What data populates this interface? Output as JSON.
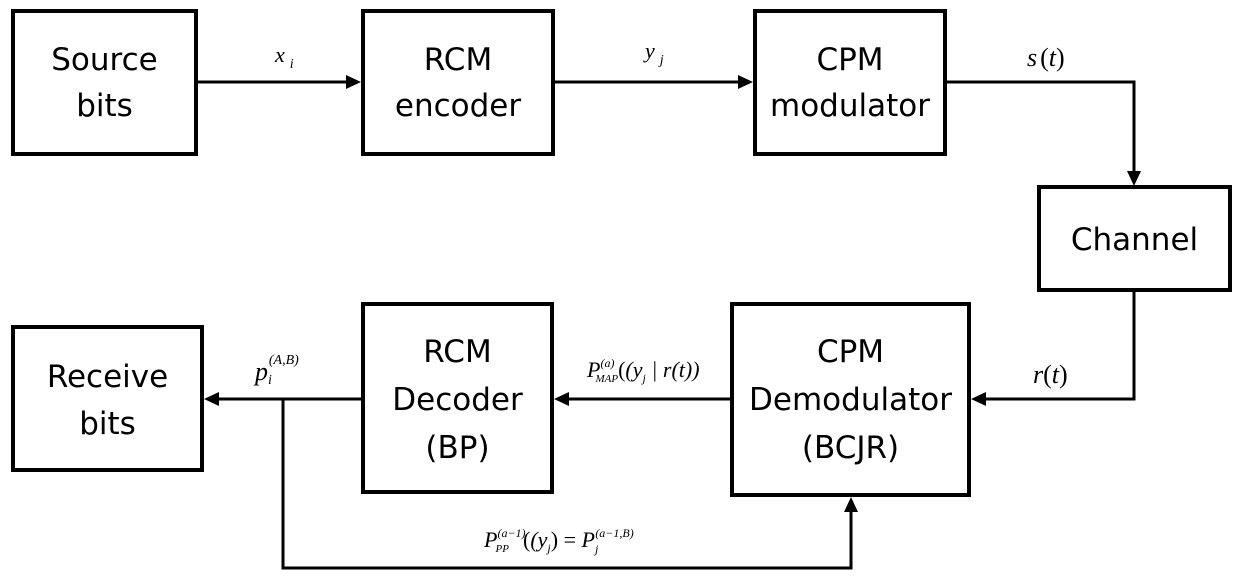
{
  "diagram": {
    "type": "block-diagram",
    "colors": {
      "stroke": "#000000",
      "background": "#ffffff",
      "text": "#000000"
    },
    "blocks": {
      "source_bits": {
        "lines": [
          "Source",
          "bits"
        ]
      },
      "rcm_encoder": {
        "lines": [
          "RCM",
          "encoder"
        ]
      },
      "cpm_modulator": {
        "lines": [
          "CPM",
          "modulator"
        ]
      },
      "channel": {
        "lines": [
          "Channel"
        ]
      },
      "cpm_demodulator": {
        "lines": [
          "CPM",
          "Demodulator",
          "(BCJR)"
        ]
      },
      "rcm_decoder": {
        "lines": [
          "RCM",
          "Decoder",
          "(BP)"
        ]
      },
      "receive_bits": {
        "lines": [
          "Receive",
          "bits"
        ]
      }
    },
    "edges": {
      "source_to_encoder": {
        "label_base": "x",
        "label_sub": "i"
      },
      "encoder_to_modulator": {
        "label_base": "y",
        "label_sub": "j"
      },
      "modulator_to_channel": {
        "label": "s(t)",
        "label_base": "s",
        "label_arg": "t"
      },
      "channel_to_demodulator": {
        "label": "r(t)",
        "label_base": "r",
        "label_arg": "t"
      },
      "demodulator_to_decoder": {
        "label_base": "P",
        "label_sup": "(a)",
        "label_sub": "MAP",
        "label_tail_y": "(y",
        "label_tail_j": "j",
        "label_tail_rest": " | r(t))"
      },
      "decoder_to_receive": {
        "label_base": "p",
        "label_sub": "i",
        "label_sup": "(A,B)"
      },
      "feedback_to_demodulator": {
        "lhs_base": "P",
        "lhs_sup": "(a−1)",
        "lhs_sub": "PP",
        "lhs_arg_open": "(y",
        "lhs_arg_sub": "j",
        "lhs_arg_close": ")",
        "equals": " = ",
        "rhs_base": "P",
        "rhs_sub": "j",
        "rhs_sup": "(a−1,B)"
      }
    }
  }
}
